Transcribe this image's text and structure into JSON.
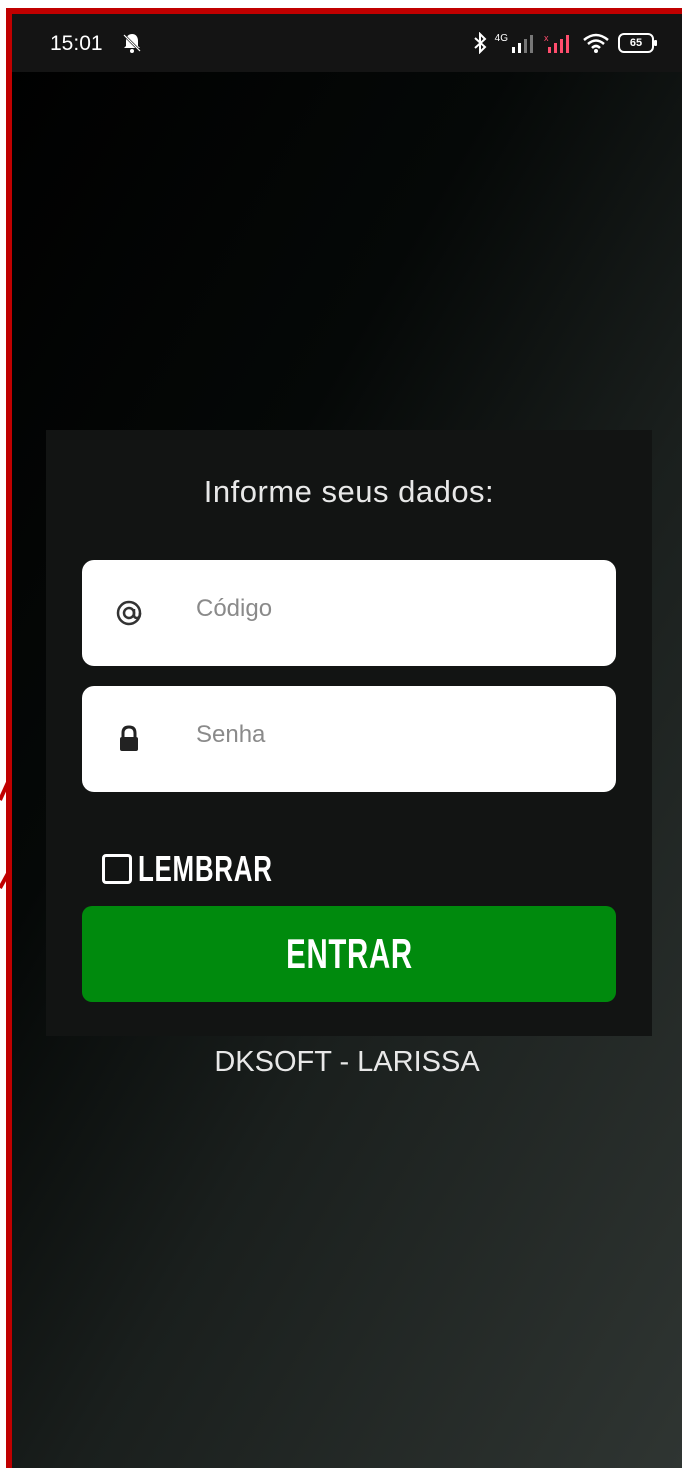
{
  "status_bar": {
    "time": "15:01",
    "network_label": "4G",
    "battery": "65"
  },
  "login": {
    "title": "Informe seus dados:",
    "code_placeholder": "Código",
    "password_placeholder": "Senha",
    "remember_label": "LEMBRAR",
    "enter_label": "ENTRAR"
  },
  "footer": {
    "text": "DKSOFT - LARISSA"
  },
  "colors": {
    "enter_button": "#008a0d",
    "frame_border": "#c00000",
    "card_bg": "#121413"
  },
  "icons": [
    "bell-off-icon",
    "bluetooth-icon",
    "signal-icon",
    "wifi-icon",
    "battery-icon",
    "at-icon",
    "lock-icon"
  ]
}
